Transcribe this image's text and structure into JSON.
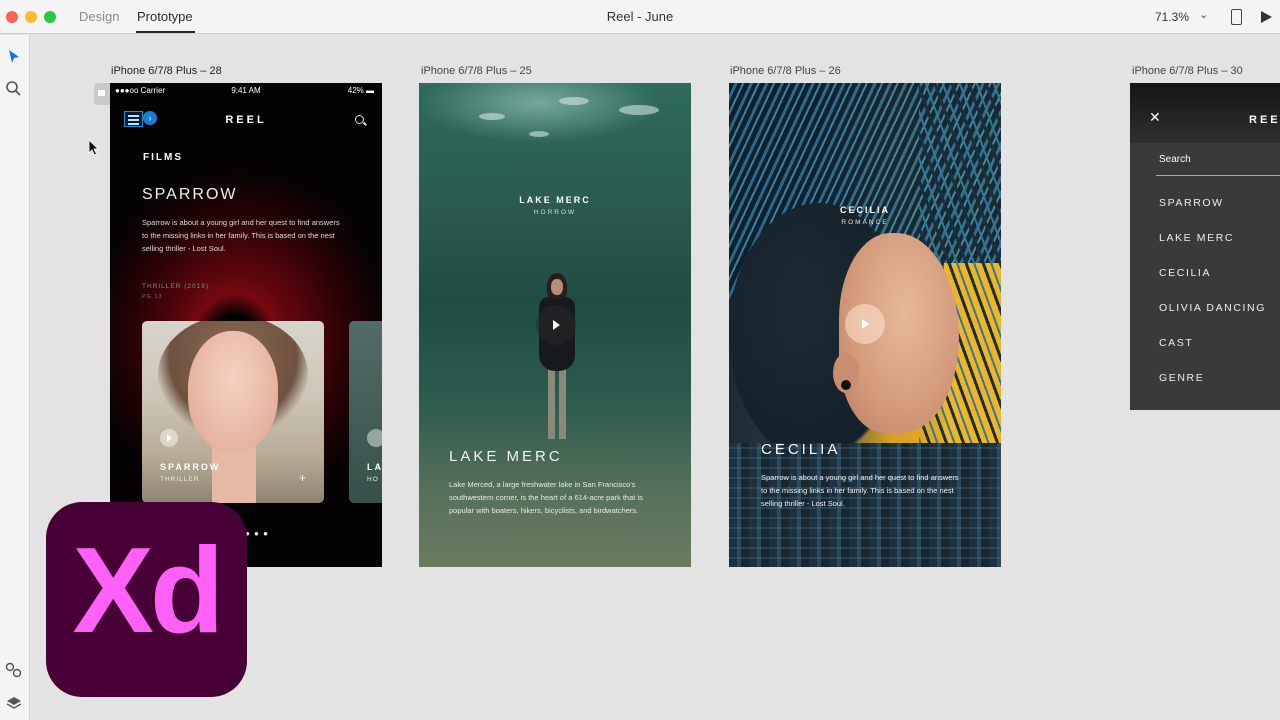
{
  "titlebar": {
    "tabs": [
      {
        "label": "Design"
      },
      {
        "label": "Prototype"
      }
    ],
    "title": "Reel - June",
    "zoom": "71.3%"
  },
  "artboards": [
    {
      "label": "iPhone 6/7/8 Plus – 28",
      "status": {
        "carrier": "●●●oo Carrier ",
        "time": "9:41 AM",
        "battery": "42% ▬"
      },
      "logo": "REEL",
      "section": "FILMS",
      "title": "SPARROW",
      "description": "Sparrow is about a young girl and her quest to find answers to the missing links in her family. This is based on the nest selling thriller - Lost Soul.",
      "genre": "THRILLER (2018)",
      "rating": "PG 13",
      "cards": [
        {
          "title": "SPARROW",
          "subtitle": "THRILLER"
        },
        {
          "title": "LA",
          "subtitle": "HO"
        }
      ]
    },
    {
      "label": "iPhone 6/7/8 Plus – 25",
      "name": "LAKE MERC",
      "genre": "HORROW",
      "title": "LAKE MERC",
      "description": "Lake Merced, a large freshwater lake in San Francisco's southwestern corner, is the heart of a 614-acre park that is popular with boaters, hikers, bicyclists, and birdwatchers."
    },
    {
      "label": "iPhone 6/7/8 Plus – 26",
      "name": "CECILIA",
      "genre": "ROMANCE",
      "title": "CECILIA",
      "description": "Sparrow is about a young girl and her quest to find answers to the missing links in her family. This is based on the nest selling thriller - Lost Soul."
    },
    {
      "label": "iPhone 6/7/8 Plus – 30",
      "logo": "REEL",
      "search": "Search",
      "menu": [
        "SPARROW",
        "LAKE MERC",
        "CECILIA",
        "OLIVIA DANCING",
        "CAST",
        "GENRE"
      ]
    }
  ],
  "logo_badge": {
    "text": "Xd",
    "bg": "#470137",
    "fg": "#ff61f6"
  }
}
